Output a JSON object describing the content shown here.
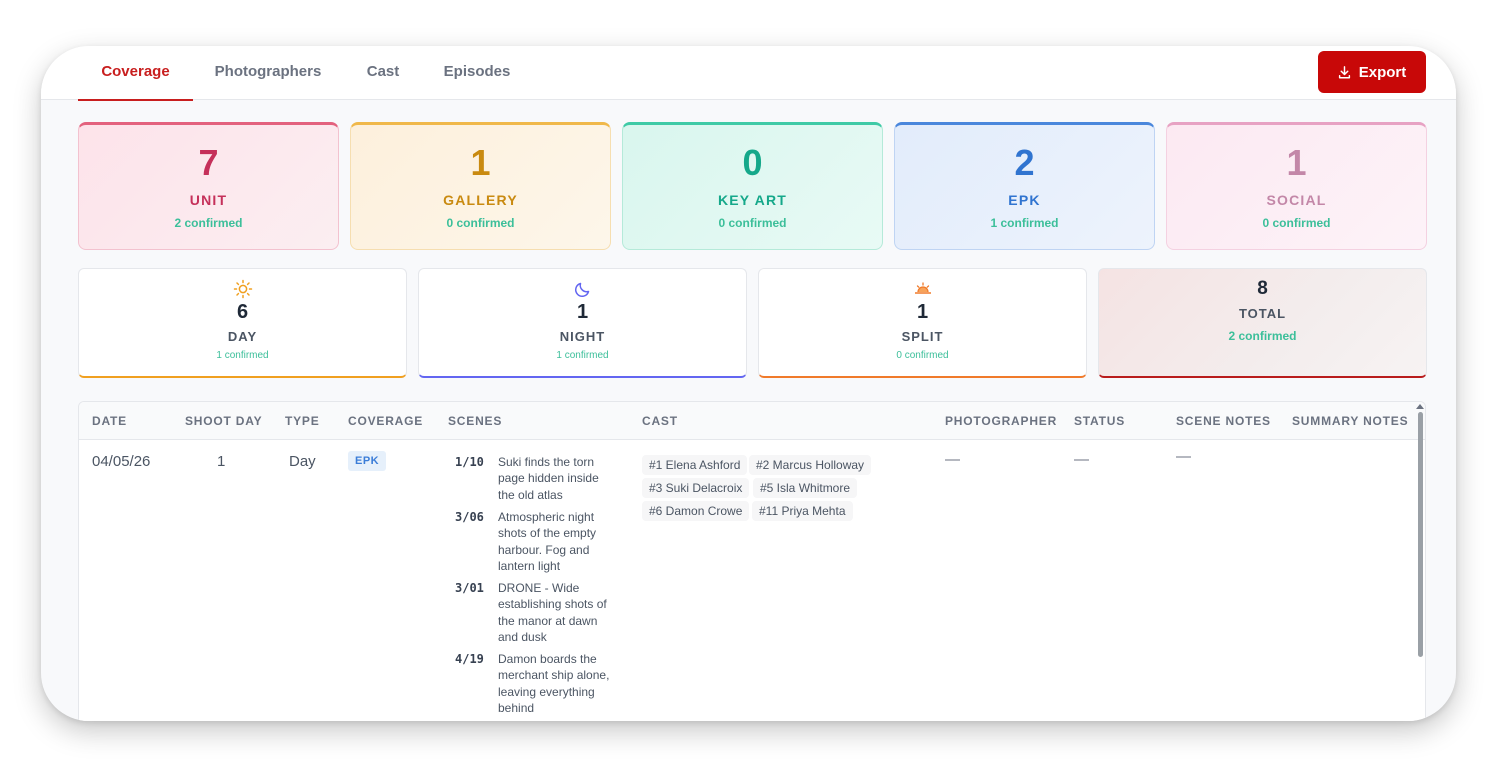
{
  "tabs": [
    {
      "label": "Coverage",
      "active": true
    },
    {
      "label": "Photographers"
    },
    {
      "label": "Cast"
    },
    {
      "label": "Episodes"
    }
  ],
  "export_button": {
    "label": "Export",
    "icon": "download-icon"
  },
  "categories": [
    {
      "count": "7",
      "label": "UNIT",
      "confirmed": "2 confirmed",
      "color": "#c5305a"
    },
    {
      "count": "1",
      "label": "GALLERY",
      "confirmed": "0 confirmed",
      "color": "#c98a10"
    },
    {
      "count": "0",
      "label": "KEY ART",
      "confirmed": "0 confirmed",
      "color": "#15a88a"
    },
    {
      "count": "2",
      "label": "EPK",
      "confirmed": "1 confirmed",
      "color": "#3074d0"
    },
    {
      "count": "1",
      "label": "SOCIAL",
      "confirmed": "0 confirmed",
      "color": "#c387a8"
    }
  ],
  "shifts": [
    {
      "count": "6",
      "label": "DAY",
      "confirmed": "1 confirmed",
      "icon": "sun-icon",
      "color": "#f0a020"
    },
    {
      "count": "1",
      "label": "NIGHT",
      "confirmed": "1 confirmed",
      "icon": "moon-icon",
      "color": "#6366f1"
    },
    {
      "count": "1",
      "label": "SPLIT",
      "confirmed": "0 confirmed",
      "icon": "sunset-icon",
      "color": "#f07a2a"
    },
    {
      "count": "8",
      "label": "TOTAL",
      "confirmed": "2 confirmed",
      "color": "#b91c1c"
    }
  ],
  "table": {
    "columns": [
      "DATE",
      "SHOOT DAY",
      "TYPE",
      "COVERAGE",
      "SCENES",
      "CAST",
      "PHOTOGRAPHER",
      "STATUS",
      "SCENE NOTES",
      "SUMMARY NOTES"
    ],
    "rows": [
      {
        "date": "04/05/26",
        "shoot_day": "1",
        "type": "Day",
        "coverage": "EPK",
        "scenes": [
          {
            "num": "1/10",
            "desc": "Suki finds the torn page hidden inside the old atlas"
          },
          {
            "num": "3/06",
            "desc": "Atmospheric night shots of the empty harbour. Fog and lantern light"
          },
          {
            "num": "3/01",
            "desc": "DRONE - Wide establishing shots of the manor at dawn and dusk"
          },
          {
            "num": "4/19",
            "desc": "Damon boards the merchant ship alone, leaving everything behind"
          }
        ],
        "cast": [
          "#1 Elena Ashford",
          "#2 Marcus Holloway",
          "#3 Suki Delacroix",
          "#5 Isla Whitmore",
          "#6 Damon Crowe",
          "#11 Priya Mehta"
        ],
        "photographer": "—",
        "status": "—",
        "scene_notes": "—"
      }
    ]
  }
}
